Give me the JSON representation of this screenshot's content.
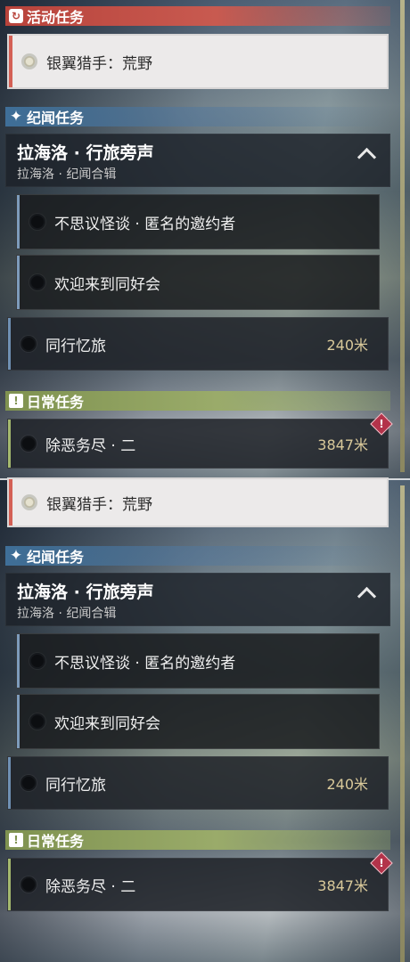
{
  "panel1": {
    "active_header": "活动任务",
    "active_quest": "银翼猎手：荒野",
    "story_header": "纪闻任务",
    "group_title": "拉海洛 · 行旅旁声",
    "group_subtitle": "拉海洛 · 纪闻合辑",
    "sub_quests": [
      "不思议怪谈 · 匿名的邀约者",
      "欢迎来到同好会"
    ],
    "story_quest": {
      "title": "同行忆旅",
      "distance": "240米"
    },
    "daily_header": "日常任务",
    "daily_quest": {
      "title": "除恶务尽 · 二",
      "distance": "3847米"
    }
  },
  "panel2": {
    "active_quest": "银翼猎手：荒野",
    "story_header": "纪闻任务",
    "group_title": "拉海洛 · 行旅旁声",
    "group_subtitle": "拉海洛 · 纪闻合辑",
    "sub_quests": [
      "不思议怪谈 · 匿名的邀约者",
      "欢迎来到同好会"
    ],
    "story_quest": {
      "title": "同行忆旅",
      "distance": "240米"
    },
    "daily_header": "日常任务",
    "daily_quest": {
      "title": "除恶务尽 · 二",
      "distance": "3847米"
    }
  },
  "colors": {
    "active": "#c85a50",
    "story": "#3f6f98",
    "daily": "#9aab6a",
    "alert": "#b3334a"
  },
  "icons": {
    "active": "refresh-icon",
    "story": "star-icon",
    "daily": "exclamation-icon",
    "alert": "alert-diamond-icon",
    "expand": "chevron-up-icon"
  }
}
